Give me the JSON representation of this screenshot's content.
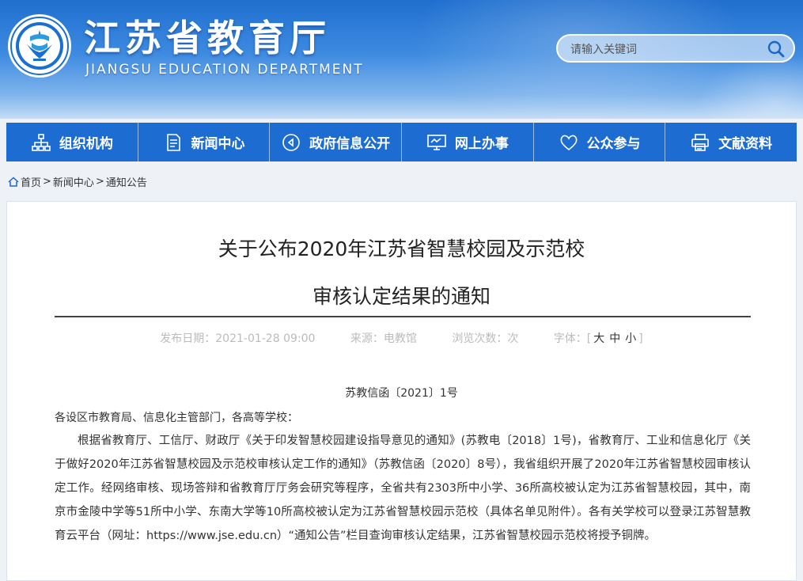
{
  "header": {
    "title": "江苏省教育厅",
    "subtitle": "JIANGSU EDUCATION DEPARTMENT"
  },
  "search": {
    "placeholder": "请输入关键词",
    "icon": "search-icon"
  },
  "nav": {
    "items": [
      {
        "label": "组织机构",
        "icon": "org-chart-icon"
      },
      {
        "label": "新闻中心",
        "icon": "document-icon"
      },
      {
        "label": "政府信息公开",
        "icon": "play-circle-icon"
      },
      {
        "label": "网上办事",
        "icon": "monitor-icon"
      },
      {
        "label": "公众参与",
        "icon": "heart-icon"
      },
      {
        "label": "文献资料",
        "icon": "printer-icon"
      }
    ]
  },
  "breadcrumb": {
    "home": "首页",
    "sep": ">",
    "items": [
      "新闻中心",
      "通知公告"
    ]
  },
  "article": {
    "title_line1": "关于公布2020年江苏省智慧校园及示范校",
    "title_line2": "审核认定结果的通知",
    "meta": {
      "date": "发布日期：2021-01-28 09:00",
      "source": "来源：电教馆",
      "views": "浏览次数：次",
      "font_label": "字体：[",
      "font_large": "大",
      "font_medium": "中",
      "font_small": "小",
      "font_close": "]"
    },
    "doc_number": "苏教信函〔2021〕1号",
    "salutation": "各设区市教育局、信息化主管部门，各高等学校：",
    "body": "根据省教育厅、工信厅、财政厅《关于印发智慧校园建设指导意见的通知》(苏教电〔2018〕1号)，省教育厅、工业和信息化厅《关于做好2020年江苏省智慧校园及示范校审核认定工作的通知》（苏教信函〔2020〕8号），我省组织开展了2020年江苏省智慧校园审核认定工作。经网络审核、现场答辩和省教育厅厅务会研究等程序，全省共有2303所中小学、36所高校被认定为江苏省智慧校园，其中，南京市金陵中学等51所中小学、东南大学等10所高校被认定为江苏省智慧校园示范校（具体名单见附件）。各有关学校可以登录江苏智慧教育云平台（网址：https://www.jse.edu.cn）“通知公告”栏目查询审核认定结果，江苏省智慧校园示范校将授予铜牌。"
  },
  "colors": {
    "nav_bg": "#1d6cd1",
    "header_top": "#1f6fcf",
    "text": "#333333",
    "meta_text": "#bbbbbb"
  }
}
